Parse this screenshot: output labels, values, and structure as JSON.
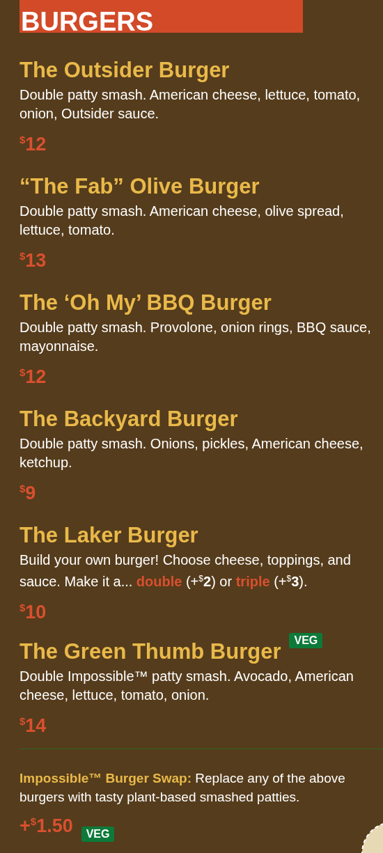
{
  "section": {
    "title": "BURGERS"
  },
  "items": [
    {
      "name": "The Outsider Burger",
      "description": [
        {
          "kind": "plain",
          "text": "Double patty smash. American cheese, lettuce, tomato, onion, Outsider sauce."
        }
      ],
      "price": {
        "currency": "$",
        "amount": "12"
      }
    },
    {
      "name": "“The Fab” Olive Burger",
      "description": [
        {
          "kind": "plain",
          "text": "Double patty smash. American cheese, olive spread, lettuce, tomato."
        }
      ],
      "price": {
        "currency": "$",
        "amount": "13"
      }
    },
    {
      "name": "The ‘Oh My’ BBQ Burger",
      "description": [
        {
          "kind": "plain",
          "text": "Double patty smash. Provolone, onion rings, BBQ sauce, mayonnaise."
        }
      ],
      "price": {
        "currency": "$",
        "amount": "12"
      }
    },
    {
      "name": "The Backyard Burger",
      "description": [
        {
          "kind": "plain",
          "text": "Double patty smash. Onions, pickles, American cheese, ketchup."
        }
      ],
      "price": {
        "currency": "$",
        "amount": "9"
      }
    },
    {
      "name": "The Laker Burger",
      "description": [
        {
          "kind": "plain",
          "text": "Build your own burger! Choose cheese, toppings, and sauce. Make it a... "
        },
        {
          "kind": "accent",
          "text": "double"
        },
        {
          "kind": "plain",
          "text": " (+"
        },
        {
          "kind": "sup",
          "text": "$"
        },
        {
          "kind": "bold",
          "text": "2"
        },
        {
          "kind": "plain",
          "text": ") or "
        },
        {
          "kind": "accent",
          "text": "triple"
        },
        {
          "kind": "plain",
          "text": " (+"
        },
        {
          "kind": "sup",
          "text": "$"
        },
        {
          "kind": "bold",
          "text": "3"
        },
        {
          "kind": "plain",
          "text": ")."
        }
      ],
      "price": {
        "currency": "$",
        "amount": "10"
      }
    },
    {
      "name": "The Green Thumb Burger",
      "badge": "VEG",
      "description": [
        {
          "kind": "plain",
          "text": "Double Impossible™ patty smash. Avocado, American cheese, lettuce, tomato, onion."
        }
      ],
      "price": {
        "currency": "$",
        "amount": "14"
      }
    }
  ],
  "swap": {
    "label": "Impossible™ Burger Swap:",
    "text": "Replace any of the above burgers with tasty plant-based smashed patties.",
    "price": {
      "prefix": "+",
      "currency": "$",
      "amount": "1.50"
    },
    "badge": "VEG"
  }
}
